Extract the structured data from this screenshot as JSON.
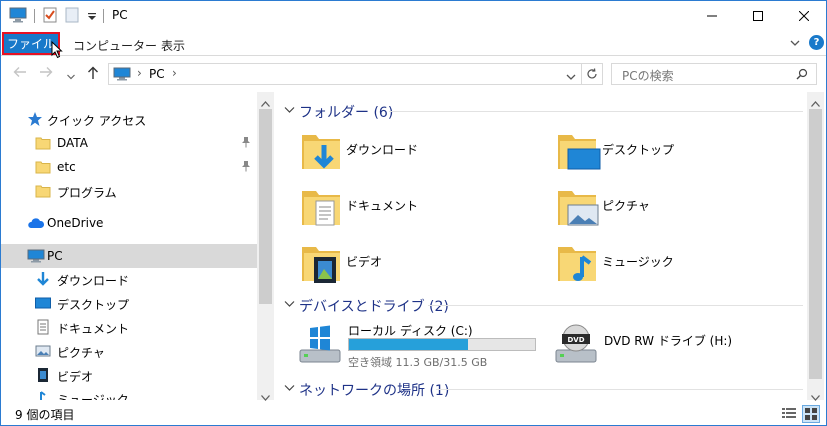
{
  "window": {
    "title": "PC"
  },
  "ribbon": {
    "tabs": [
      {
        "label": "ファイル",
        "selected": true
      },
      {
        "label": "コンピューター",
        "selected": false
      },
      {
        "label": "表示",
        "selected": false
      }
    ]
  },
  "address": {
    "path": "PC",
    "search_placeholder": "PCの検索"
  },
  "navpane": {
    "quick_access": "クイック アクセス",
    "pinned": [
      {
        "label": "DATA",
        "pinned": true
      },
      {
        "label": "etc",
        "pinned": true
      },
      {
        "label": "プログラム",
        "pinned": false
      }
    ],
    "onedrive": "OneDrive",
    "pc": "PC",
    "pc_children": [
      {
        "label": "ダウンロード",
        "icon": "download-icon"
      },
      {
        "label": "デスクトップ",
        "icon": "desktop-icon"
      },
      {
        "label": "ドキュメント",
        "icon": "document-icon"
      },
      {
        "label": "ピクチャ",
        "icon": "pictures-icon"
      },
      {
        "label": "ビデオ",
        "icon": "video-icon"
      },
      {
        "label": "ミュージック",
        "icon": "music-icon"
      }
    ]
  },
  "content": {
    "folders_header": "フォルダー (6)",
    "folders": [
      {
        "label": "ダウンロード",
        "icon": "download-folder-icon"
      },
      {
        "label": "デスクトップ",
        "icon": "desktop-folder-icon"
      },
      {
        "label": "ドキュメント",
        "icon": "documents-folder-icon"
      },
      {
        "label": "ピクチャ",
        "icon": "pictures-folder-icon"
      },
      {
        "label": "ビデオ",
        "icon": "videos-folder-icon"
      },
      {
        "label": "ミュージック",
        "icon": "music-folder-icon"
      }
    ],
    "devices_header": "デバイスとドライブ (2)",
    "drives": [
      {
        "name": "ローカル ディスク (C:)",
        "free": "空き領域 11.3 GB/31.5 GB",
        "used_fraction": 0.64,
        "icon": "windows-drive-icon"
      },
      {
        "name": "DVD RW ドライブ (H:)",
        "icon": "dvd-drive-icon"
      }
    ],
    "network_header": "ネットワークの場所 (1)"
  },
  "status": {
    "text": "9 個の項目"
  },
  "colors": {
    "accent": "#1979ca",
    "group_title": "#1e3287",
    "drive_bar": "#26a0da",
    "folder": "#f8d775"
  }
}
